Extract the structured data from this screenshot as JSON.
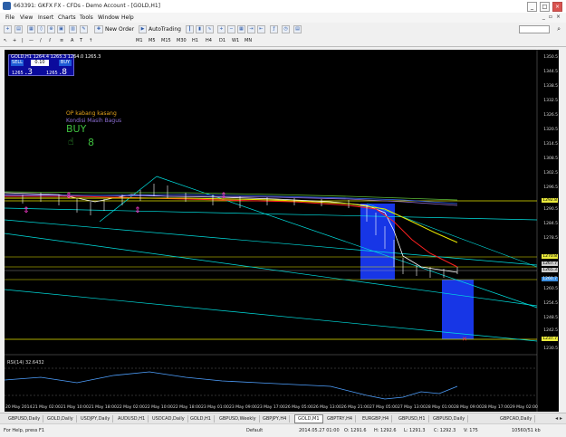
{
  "window": {
    "title": "663391: GKFX FX - CFDs - Demo Account - [GOLD,H1]"
  },
  "menu": {
    "items": [
      "File",
      "View",
      "Insert",
      "Charts",
      "Tools",
      "Window",
      "Help"
    ]
  },
  "toolbar": {
    "new_order": "New Order",
    "autotrading": "AutoTrading"
  },
  "timeframes": [
    "M1",
    "M5",
    "M15",
    "M30",
    "H1",
    "H4",
    "D1",
    "W1",
    "MN"
  ],
  "trade_panel": {
    "symbol_line": "GOLD,H1  1264.4 1265.3 1264.0 1265.3",
    "sell": "SELL",
    "buy": "BUY",
    "lot": "0.10",
    "bid_small": "1265",
    "bid_big": ".3",
    "ask_small": "1265",
    "ask_big": ".8"
  },
  "indicator_text": {
    "line1": "OP kabang kasang",
    "line2": "Kondisi Masih Bagus",
    "line3": "BUY",
    "digit": "8"
  },
  "rsi_label": "RSI(14) 32.6432",
  "price_axis": [
    "1350.5",
    "1344.5",
    "1338.5",
    "1332.5",
    "1326.5",
    "1320.5",
    "1314.5",
    "1308.5",
    "1302.5",
    "1296.5",
    "1290.5",
    "1284.5",
    "1278.5",
    "1272.5",
    "1266.5",
    "1260.5",
    "1254.5",
    "1248.5",
    "1242.5",
    "1236.5",
    "1230.5"
  ],
  "price_markers": {
    "m1": "1292.8",
    "m2": "1270.8",
    "m3": "1267.7",
    "m4": "1265.3",
    "m5": "1260.7",
    "m6": "1237.7"
  },
  "date_axis": [
    "20 May 2014",
    "21 May 02:00",
    "21 May 10:00",
    "21 May 18:00",
    "22 May 02:00",
    "22 May 10:00",
    "22 May 18:00",
    "23 May 01:00",
    "23 May 09:00",
    "23 May 17:00",
    "26 May 05:00",
    "26 May 13:00",
    "26 May 21:00",
    "27 May 05:00",
    "27 May 13:00",
    "28 May 01:00",
    "28 May 09:00",
    "28 May 17:00",
    "29 May 02:00",
    "29 May 10:00"
  ],
  "tabs": [
    "GBPUSD,Daily",
    "GOLD,Daily",
    "USDJPY,Daily",
    "AUDUSD,H1",
    "USDCAD,Daily",
    "GOLD,H1",
    "GBPUSD,Weekly",
    "GBPJPY,H4",
    "GOLD,M1",
    "GBPTRY,H4",
    "EURGBP,H4",
    "GBPUSD,H1",
    "GBPUSD,Daily",
    "GBPCAD,Daily"
  ],
  "active_tab": "GOLD,M1",
  "status": {
    "help": "For Help, press F1",
    "profile": "Default",
    "time": "2014.05.27 01:00",
    "open": "O: 1291.6",
    "high": "H: 1292.6",
    "low": "L: 1291.3",
    "close": "C: 1292.3",
    "volume": "V: 175",
    "traffic": "10560/51 kb"
  },
  "colors": {
    "chart_bg": "#000000",
    "trendline": "#00e0e0",
    "hline": "#e6e600",
    "box": "#1a3cff",
    "candles": "#ffffff",
    "ma_red": "#ff2020",
    "ma_yellow": "#e6e600",
    "rsi": "#4ea0ff"
  },
  "icons": [
    "app-icon",
    "new-chart-icon",
    "zoom-in-icon",
    "zoom-out-icon",
    "navigator-icon",
    "search-icon",
    "buy-hand-icon",
    "arrow-marker-icon"
  ]
}
